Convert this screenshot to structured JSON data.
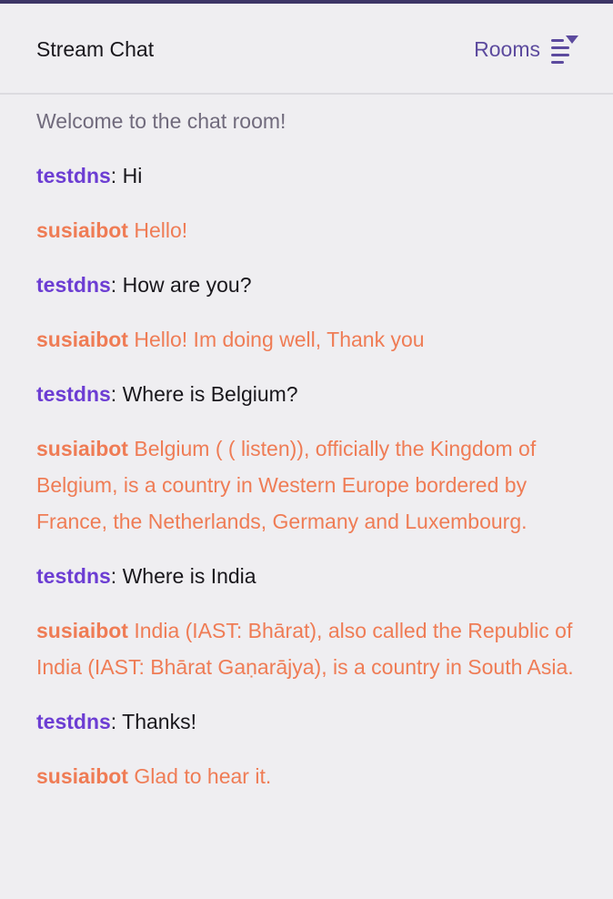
{
  "header": {
    "title": "Stream Chat",
    "rooms_label": "Rooms",
    "rooms_icon": "rooms-menu-icon"
  },
  "colors": {
    "accent_bar": "#3d3566",
    "background": "#efeef1",
    "user_name": "#6c3dd3",
    "bot": "#ef7c55",
    "rooms": "#5c4a9e"
  },
  "chat": {
    "welcome": "Welcome to the chat room!",
    "messages": [
      {
        "sender": "testdns",
        "sep": ":",
        "text": " Hi"
      },
      {
        "sender": "susiaibot",
        "text": " Hello!"
      },
      {
        "sender": "testdns",
        "sep": ":",
        "text": " How are you?"
      },
      {
        "sender": "susiaibot",
        "text": " Hello! Im doing well, Thank you"
      },
      {
        "sender": "testdns",
        "sep": ":",
        "text": " Where is Belgium?"
      },
      {
        "sender": "susiaibot",
        "text": " Belgium ( ( listen)), officially the Kingdom of Belgium, is a country in Western Europe bordered by France, the Netherlands, Germany and Luxembourg."
      },
      {
        "sender": "testdns",
        "sep": ":",
        "text": " Where is India"
      },
      {
        "sender": "susiaibot",
        "text": " India (IAST: Bhārat), also called the Republic of India (IAST: Bhārat Gaṇarājya), is a country in South Asia."
      },
      {
        "sender": "testdns",
        "sep": ":",
        "text": " Thanks!"
      },
      {
        "sender": "susiaibot",
        "text": " Glad to hear it."
      }
    ]
  }
}
